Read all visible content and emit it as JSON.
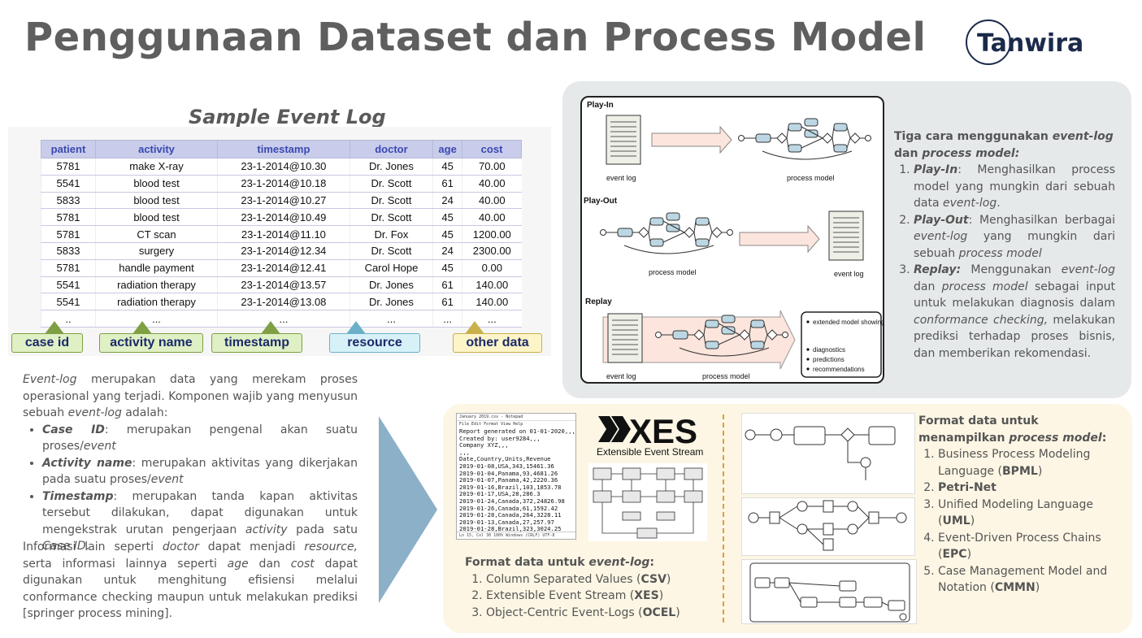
{
  "title": "Penggunaan Dataset dan Process Model",
  "logo": {
    "text": "Tanwira"
  },
  "sample": {
    "title": "Sample Event Log",
    "columns": [
      "patient",
      "activity",
      "timestamp",
      "doctor",
      "age",
      "cost"
    ],
    "rows": [
      [
        "5781",
        "make X-ray",
        "23-1-2014@10.30",
        "Dr. Jones",
        "45",
        "70.00"
      ],
      [
        "5541",
        "blood test",
        "23-1-2014@10.18",
        "Dr. Scott",
        "61",
        "40.00"
      ],
      [
        "5833",
        "blood test",
        "23-1-2014@10.27",
        "Dr. Scott",
        "24",
        "40.00"
      ],
      [
        "5781",
        "blood test",
        "23-1-2014@10.49",
        "Dr. Scott",
        "45",
        "40.00"
      ],
      [
        "5781",
        "CT scan",
        "23-1-2014@11.10",
        "Dr. Fox",
        "45",
        "1200.00"
      ],
      [
        "5833",
        "surgery",
        "23-1-2014@12.34",
        "Dr. Scott",
        "24",
        "2300.00"
      ],
      [
        "5781",
        "handle payment",
        "23-1-2014@12.41",
        "Carol Hope",
        "45",
        "0.00"
      ],
      [
        "5541",
        "radiation therapy",
        "23-1-2014@13.57",
        "Dr. Jones",
        "61",
        "140.00"
      ],
      [
        "5541",
        "radiation therapy",
        "23-1-2014@13.08",
        "Dr. Jones",
        "61",
        "140.00"
      ],
      [
        "..",
        "...",
        "...",
        "...",
        "...",
        "..."
      ]
    ],
    "callouts": {
      "case_id": "case id",
      "activity_name": "activity name",
      "timestamp": "timestamp",
      "resource": "resource",
      "other_data": "other data"
    }
  },
  "left_text": {
    "p1_em": "Event-log",
    "p1_rest": " merupakan data yang merekam proses operasional yang terjadi. Komponen wajib yang menyusun sebuah ",
    "p1_em2": "event-log",
    "p1_end": " adalah:",
    "b1_term": "Case ID",
    "b1_text": ": merupakan pengenal akan suatu proses/",
    "b1_em": "event",
    "b2_term": "Activity name",
    "b2_text": ": merupakan aktivitas yang dikerjakan pada suatu proses/",
    "b2_em": "event",
    "b3_term": "Timestamp",
    "b3_text": ": merupakan tanda kapan aktivitas tersebut dilakukan, dapat digunakan untuk mengekstrak urutan pengerjaan ",
    "b3_em": "activity",
    "b3_mid": " pada satu ",
    "b3_em2": "Case ID",
    "b3_end": ".",
    "p2_a": "Informasi lain seperti ",
    "p2_em1": "doctor",
    "p2_b": " dapat menjadi ",
    "p2_em2": "resource,",
    "p2_c": " serta informasi lainnya seperti ",
    "p2_em3": "age",
    "p2_d": " dan ",
    "p2_em4": "cost",
    "p2_e": " dapat digunakan untuk menghitung efisiensi melalui conformance checking maupun untuk melakukan prediksi [springer process mining]."
  },
  "diagram": {
    "play_in": "Play-In",
    "play_out": "Play-Out",
    "replay": "Replay",
    "event_log": "event log",
    "process_model": "process model",
    "replay_box": [
      "extended model showing times, frequencies, etc.",
      "diagnostics",
      "predictions",
      "recommendations"
    ]
  },
  "right_text": {
    "head_a": "Tiga cara menggunakan ",
    "head_em1": "event-log",
    "head_b": " dan ",
    "head_em2": "process model:",
    "i1_term": "Play-In",
    "i1_a": ": Menghasilkan process model yang mungkin dari sebuah data ",
    "i1_em": "event-log",
    "i1_end": ".",
    "i2_term": "Play-Out",
    "i2_a": ": Menghasilkan berbagai ",
    "i2_em": "event-log",
    "i2_b": " yang mungkin dari sebuah ",
    "i2_em2": "process model",
    "i3_term": "Replay:",
    "i3_a": " Menggunakan ",
    "i3_em": "event-log",
    "i3_b": " dan ",
    "i3_em2": "process model",
    "i3_c": " sebagai input untuk melakukan diagnosis dalam ",
    "i3_em3": "conformance checking,",
    "i3_d": " melakukan prediksi terhadap proses bisnis, dan memberikan rekomendasi."
  },
  "notepad": {
    "title": "January 2019.csv - Notepad",
    "menu": "File  Edit  Format  View  Help",
    "content": "Report generated on 01-01-2020,,,\nCreated by: user9284,,,\nCompany XYZ,,,\n,,,\nDate,Country,Units,Revenue\n2019-01-08,USA,343,15461.36\n2019-01-04,Panama,93,4681.26\n2019-01-07,Panama,42,2220.36\n2019-01-16,Brazil,103,1853.78\n2019-01-17,USA,28,286.3\n2019-01-24,Canada,372,24826.98\n2019-01-26,Canada,61,1592.42\n2019-01-28,Canada,264,3228.11\n2019-01-13,Canada,27,257.97\n2019-01-28,Brazil,323,3024.25",
    "status": "Ln 15, Col 30     100%   Windows (CRLF)   UTF-8"
  },
  "xes": {
    "logo": "XES",
    "subtitle": "Extensible Event Stream"
  },
  "event_log_format": {
    "head_a": "Format data untuk ",
    "head_em": "event-log",
    "head_b": ":",
    "items": [
      {
        "text": "Column Separated Values (",
        "bold": "CSV",
        "end": ")"
      },
      {
        "text": "Extensible Event Stream (",
        "bold": "XES",
        "end": ")"
      },
      {
        "text": "Object-Centric Event-Logs (",
        "bold": "OCEL",
        "end": ")"
      }
    ]
  },
  "process_model_format": {
    "head_a": "Format data untuk menampilkan ",
    "head_em": "process model",
    "head_b": ":",
    "items": [
      {
        "text": "Business Process Modeling Language (",
        "bold": "BPML",
        "end": ")"
      },
      {
        "text": "",
        "bold": "Petri-Net",
        "end": ""
      },
      {
        "text": "Unified Modeling Language (",
        "bold": "UML",
        "end": ")"
      },
      {
        "text": "Event-Driven Process Chains (",
        "bold": "EPC",
        "end": ")"
      },
      {
        "text": "Case Management Model and Notation (",
        "bold": "CMMN",
        "end": ")"
      }
    ]
  },
  "colors": {
    "table_header": "#c9cdeb",
    "arrow": "#8bb0c8",
    "panel_top": "#e6e9ea",
    "panel_bottom": "#fdf6e4"
  }
}
